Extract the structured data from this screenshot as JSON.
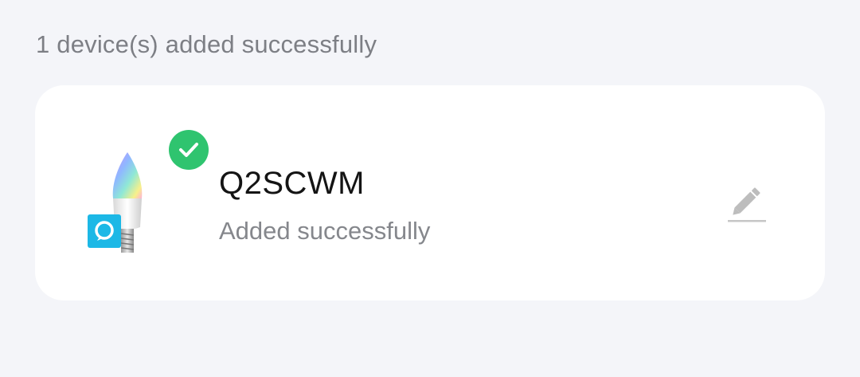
{
  "summary": {
    "text": "1 device(s) added successfully"
  },
  "device": {
    "name": "Q2SCWM",
    "status": "Added successfully",
    "image_icon": "rgb-candle-bulb-with-alexa-badge",
    "status_icon": "check-circle-icon",
    "edit_icon": "pencil-edit-icon"
  },
  "colors": {
    "background": "#f4f5f9",
    "card": "#ffffff",
    "success": "#2fc46f",
    "alexa_badge": "#1cb8e6"
  }
}
